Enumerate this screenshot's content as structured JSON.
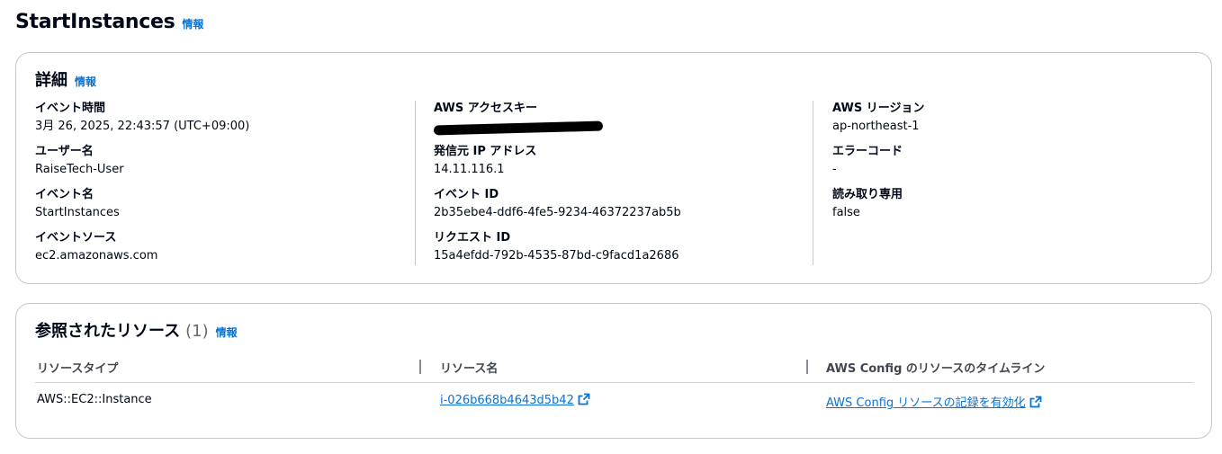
{
  "header": {
    "title": "StartInstances",
    "info": "情報"
  },
  "details": {
    "title": "詳細",
    "info": "情報",
    "col1": [
      {
        "label": "イベント時間",
        "value": "3月 26, 2025, 22:43:57 (UTC+09:00)"
      },
      {
        "label": "ユーザー名",
        "value": "RaiseTech-User"
      },
      {
        "label": "イベント名",
        "value": "StartInstances"
      },
      {
        "label": "イベントソース",
        "value": "ec2.amazonaws.com"
      }
    ],
    "col2": [
      {
        "label": "AWS アクセスキー",
        "value": ""
      },
      {
        "label": "発信元 IP アドレス",
        "value": "14.11.116.1"
      },
      {
        "label": "イベント ID",
        "value": "2b35ebe4-ddf6-4fe5-9234-46372237ab5b"
      },
      {
        "label": "リクエスト ID",
        "value": "15a4efdd-792b-4535-87bd-c9facd1a2686"
      }
    ],
    "col3": [
      {
        "label": "AWS リージョン",
        "value": "ap-northeast-1"
      },
      {
        "label": "エラーコード",
        "value": "-"
      },
      {
        "label": "読み取り専用",
        "value": "false"
      }
    ]
  },
  "resources": {
    "title": "参照されたリソース",
    "count": "(1)",
    "info": "情報",
    "columns": [
      "リソースタイプ",
      "リソース名",
      "AWS Config のリソースのタイムライン"
    ],
    "rows": [
      {
        "type": "AWS::EC2::Instance",
        "name": "i-026b668b4643d5b42",
        "config": "AWS Config リソースの記録を有効化"
      }
    ]
  },
  "colors": {
    "link": "#0972d3",
    "text": "#000716",
    "border": "#c6c6cd"
  },
  "icons": {
    "external": "external-link-icon"
  }
}
